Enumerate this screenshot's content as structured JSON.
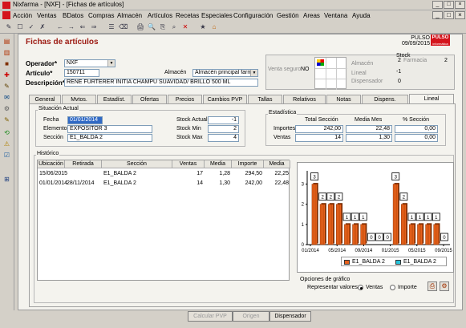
{
  "window": {
    "title": "Nixfarma - [NXF] - [Fichas de artículos]",
    "min": "_",
    "max": "□",
    "close": "×",
    "inner_min": "_",
    "inner_max": "□",
    "inner_close": "×"
  },
  "menu": [
    "Acción",
    "Ventas",
    "BDatos",
    "Compras",
    "Almacén",
    "Artículos",
    "Recetas",
    "Especiales",
    "Configuración",
    "Gestión",
    "Areas",
    "Ventana",
    "Ayuda"
  ],
  "toolbar": {
    "icons": [
      "✎",
      "☐",
      "✓",
      "✗",
      "←",
      "→",
      "⇐",
      "⇒",
      "☰",
      "⌫",
      "🖨",
      "🔍",
      "⎘",
      "⌕",
      "✕",
      "★",
      "⌂"
    ],
    "left_icons": [
      "▤",
      "▥",
      "■",
      "✚",
      "✎",
      "✉",
      "⚙",
      "✎",
      "⟲",
      "⚠",
      "☑",
      "⊞"
    ]
  },
  "form": {
    "title": "Fichas de artículos",
    "brand": "PULSO",
    "date": "09/09/2015",
    "logo": "PULSO",
    "logo_sub": "informática"
  },
  "fields": {
    "operador_label": "Operador*",
    "operador_value": "NXF",
    "articulo_label": "Artículo*",
    "articulo_value": "150711",
    "almacen_label": "Almacén",
    "almacen_value": "Almacén principal farma",
    "descripcion_label": "Descripción*",
    "descripcion_value": "RENE FURTERER INITIA CHAMPU SUAVIDAD/ BRILLO 500 ML"
  },
  "stock": {
    "venta_seguro_label": "Venta seguro",
    "venta_seguro_value": "NO",
    "stock_header": "Stock",
    "almacen_label": "Almacén",
    "almacen_value": "2",
    "farmacia_label": "Farmacia",
    "farmacia_value": "2",
    "lineal_label": "Lineal",
    "lineal_value": "-1",
    "dispensador_label": "Dispensador",
    "dispensador_value": "0"
  },
  "tabs": [
    "General",
    "Mvtos.",
    "Estadíst.",
    "Ofertas",
    "Precios",
    "Cambios PVP",
    "Tallas",
    "Relativos",
    "Notas",
    "Dispens.",
    "Lineal"
  ],
  "situacion": {
    "title": "Situación Actual",
    "fecha_label": "Fecha",
    "fecha_value": "01/01/2014",
    "elemento_label": "Elemento",
    "elemento_value": "EXPOSITOR 3",
    "seccion_label": "Sección",
    "seccion_value": "E1_BALDA 2",
    "stock_actual_label": "Stock Actual",
    "stock_actual_value": "-1",
    "stock_min_label": "Stock Min",
    "stock_min_value": "2",
    "stock_max_label": "Stock Max",
    "stock_max_value": "4"
  },
  "estadistica": {
    "title": "Estadística",
    "col_total": "Total Sección",
    "col_media": "Media Mes",
    "col_pct": "% Sección",
    "importes_label": "Importes",
    "importes_total": "242,00",
    "importes_media": "22,48",
    "importes_pct": "0,00",
    "ventas_label": "Ventas",
    "ventas_total": "14",
    "ventas_media": "1,30",
    "ventas_pct": "0,00"
  },
  "historico": {
    "title": "Histórico",
    "headers": [
      "Ubicación",
      "Retirada",
      "Sección",
      "Ventas",
      "Media",
      "Importe",
      "Media"
    ],
    "rows": [
      [
        "15/06/2015",
        "",
        "E1_BALDA 2",
        "17",
        "1,28",
        "294,50",
        "22,25"
      ],
      [
        "01/01/2014",
        "28/11/2014",
        "E1_BALDA 2",
        "14",
        "1,30",
        "242,00",
        "22,48"
      ]
    ]
  },
  "chart_data": {
    "type": "bar",
    "title": "",
    "xlabel": "",
    "ylabel": "",
    "ylim": [
      0,
      3.5
    ],
    "yticks": [
      "0",
      "1",
      "2",
      "3"
    ],
    "xticks": [
      "01/2014",
      "05/2014",
      "09/2014",
      "01/2015",
      "05/2015",
      "09/2015"
    ],
    "grid": false,
    "legend_position": "bottom",
    "series": [
      {
        "name": "E1_BALDA 2",
        "color": "#e8611c",
        "values": [
          3,
          2,
          2,
          2,
          1,
          1,
          1,
          0,
          0,
          0,
          3,
          2,
          1,
          1,
          1,
          1,
          0
        ]
      },
      {
        "name": "E1_BALDA 2",
        "color": "#27c4dc",
        "values": []
      }
    ],
    "value_labels": [
      "3",
      "2",
      "2",
      "2",
      "1",
      "1",
      "1",
      "0",
      "0",
      "0",
      "3",
      "2",
      "1",
      "1",
      "1",
      "1",
      "0"
    ],
    "options_title": "Opciones de gráfico",
    "represent_label": "Representar valores:",
    "opt_ventas": "Ventas",
    "opt_importe": "Importe"
  },
  "buttons": {
    "calcular": "Calcular PVP",
    "origen": "Origen",
    "dispensador": "Dispensador"
  }
}
